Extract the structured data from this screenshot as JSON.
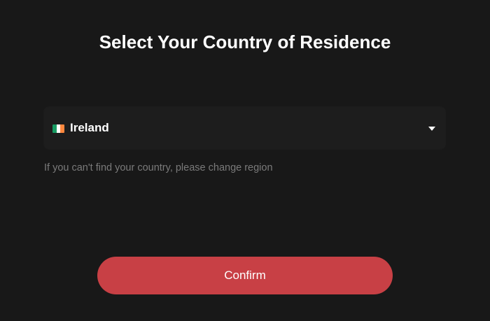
{
  "page": {
    "title": "Select Your Country of Residence"
  },
  "country_select": {
    "selected_label": "Ireland",
    "flag_icon": "ireland-flag-icon",
    "flag_colors": [
      "#169b62",
      "#ffffff",
      "#ff883e"
    ],
    "dropdown_icon": "caret-down-icon"
  },
  "hint": {
    "text": "If you can't find your country, please change region"
  },
  "confirm_button": {
    "label": "Confirm",
    "color": "#c84045"
  },
  "colors": {
    "background": "#181818",
    "select_background": "#1d1d1d",
    "hint_text": "#7a7a7a"
  }
}
